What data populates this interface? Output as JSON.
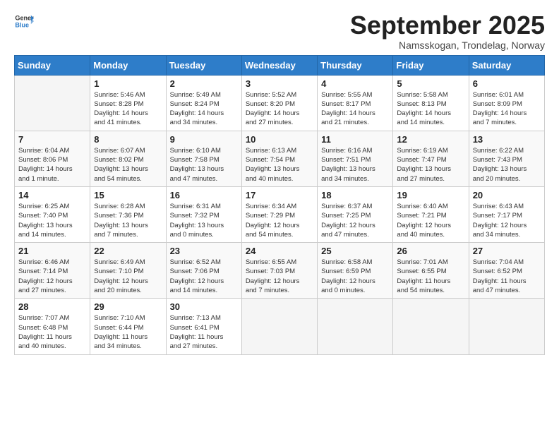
{
  "logo": {
    "general": "General",
    "blue": "Blue"
  },
  "header": {
    "month": "September 2025",
    "location": "Namsskogan, Trondelag, Norway"
  },
  "weekdays": [
    "Sunday",
    "Monday",
    "Tuesday",
    "Wednesday",
    "Thursday",
    "Friday",
    "Saturday"
  ],
  "weeks": [
    [
      {
        "day": "",
        "info": ""
      },
      {
        "day": "1",
        "info": "Sunrise: 5:46 AM\nSunset: 8:28 PM\nDaylight: 14 hours\nand 41 minutes."
      },
      {
        "day": "2",
        "info": "Sunrise: 5:49 AM\nSunset: 8:24 PM\nDaylight: 14 hours\nand 34 minutes."
      },
      {
        "day": "3",
        "info": "Sunrise: 5:52 AM\nSunset: 8:20 PM\nDaylight: 14 hours\nand 27 minutes."
      },
      {
        "day": "4",
        "info": "Sunrise: 5:55 AM\nSunset: 8:17 PM\nDaylight: 14 hours\nand 21 minutes."
      },
      {
        "day": "5",
        "info": "Sunrise: 5:58 AM\nSunset: 8:13 PM\nDaylight: 14 hours\nand 14 minutes."
      },
      {
        "day": "6",
        "info": "Sunrise: 6:01 AM\nSunset: 8:09 PM\nDaylight: 14 hours\nand 7 minutes."
      }
    ],
    [
      {
        "day": "7",
        "info": "Sunrise: 6:04 AM\nSunset: 8:06 PM\nDaylight: 14 hours\nand 1 minute."
      },
      {
        "day": "8",
        "info": "Sunrise: 6:07 AM\nSunset: 8:02 PM\nDaylight: 13 hours\nand 54 minutes."
      },
      {
        "day": "9",
        "info": "Sunrise: 6:10 AM\nSunset: 7:58 PM\nDaylight: 13 hours\nand 47 minutes."
      },
      {
        "day": "10",
        "info": "Sunrise: 6:13 AM\nSunset: 7:54 PM\nDaylight: 13 hours\nand 40 minutes."
      },
      {
        "day": "11",
        "info": "Sunrise: 6:16 AM\nSunset: 7:51 PM\nDaylight: 13 hours\nand 34 minutes."
      },
      {
        "day": "12",
        "info": "Sunrise: 6:19 AM\nSunset: 7:47 PM\nDaylight: 13 hours\nand 27 minutes."
      },
      {
        "day": "13",
        "info": "Sunrise: 6:22 AM\nSunset: 7:43 PM\nDaylight: 13 hours\nand 20 minutes."
      }
    ],
    [
      {
        "day": "14",
        "info": "Sunrise: 6:25 AM\nSunset: 7:40 PM\nDaylight: 13 hours\nand 14 minutes."
      },
      {
        "day": "15",
        "info": "Sunrise: 6:28 AM\nSunset: 7:36 PM\nDaylight: 13 hours\nand 7 minutes."
      },
      {
        "day": "16",
        "info": "Sunrise: 6:31 AM\nSunset: 7:32 PM\nDaylight: 13 hours\nand 0 minutes."
      },
      {
        "day": "17",
        "info": "Sunrise: 6:34 AM\nSunset: 7:29 PM\nDaylight: 12 hours\nand 54 minutes."
      },
      {
        "day": "18",
        "info": "Sunrise: 6:37 AM\nSunset: 7:25 PM\nDaylight: 12 hours\nand 47 minutes."
      },
      {
        "day": "19",
        "info": "Sunrise: 6:40 AM\nSunset: 7:21 PM\nDaylight: 12 hours\nand 40 minutes."
      },
      {
        "day": "20",
        "info": "Sunrise: 6:43 AM\nSunset: 7:17 PM\nDaylight: 12 hours\nand 34 minutes."
      }
    ],
    [
      {
        "day": "21",
        "info": "Sunrise: 6:46 AM\nSunset: 7:14 PM\nDaylight: 12 hours\nand 27 minutes."
      },
      {
        "day": "22",
        "info": "Sunrise: 6:49 AM\nSunset: 7:10 PM\nDaylight: 12 hours\nand 20 minutes."
      },
      {
        "day": "23",
        "info": "Sunrise: 6:52 AM\nSunset: 7:06 PM\nDaylight: 12 hours\nand 14 minutes."
      },
      {
        "day": "24",
        "info": "Sunrise: 6:55 AM\nSunset: 7:03 PM\nDaylight: 12 hours\nand 7 minutes."
      },
      {
        "day": "25",
        "info": "Sunrise: 6:58 AM\nSunset: 6:59 PM\nDaylight: 12 hours\nand 0 minutes."
      },
      {
        "day": "26",
        "info": "Sunrise: 7:01 AM\nSunset: 6:55 PM\nDaylight: 11 hours\nand 54 minutes."
      },
      {
        "day": "27",
        "info": "Sunrise: 7:04 AM\nSunset: 6:52 PM\nDaylight: 11 hours\nand 47 minutes."
      }
    ],
    [
      {
        "day": "28",
        "info": "Sunrise: 7:07 AM\nSunset: 6:48 PM\nDaylight: 11 hours\nand 40 minutes."
      },
      {
        "day": "29",
        "info": "Sunrise: 7:10 AM\nSunset: 6:44 PM\nDaylight: 11 hours\nand 34 minutes."
      },
      {
        "day": "30",
        "info": "Sunrise: 7:13 AM\nSunset: 6:41 PM\nDaylight: 11 hours\nand 27 minutes."
      },
      {
        "day": "",
        "info": ""
      },
      {
        "day": "",
        "info": ""
      },
      {
        "day": "",
        "info": ""
      },
      {
        "day": "",
        "info": ""
      }
    ]
  ]
}
